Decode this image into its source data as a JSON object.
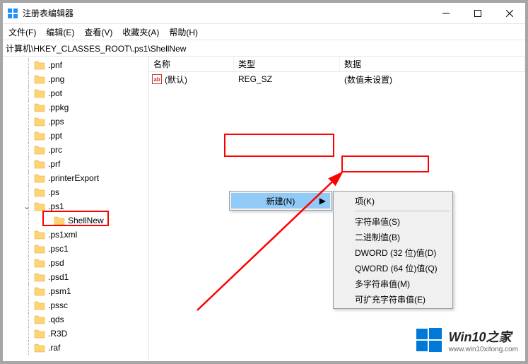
{
  "window": {
    "title": "注册表编辑器"
  },
  "menu": {
    "file": "文件(F)",
    "edit": "编辑(E)",
    "view": "查看(V)",
    "favorites": "收藏夹(A)",
    "help": "帮助(H)"
  },
  "address": "计算机\\HKEY_CLASSES_ROOT\\.ps1\\ShellNew",
  "tree": {
    "items": [
      ".pnf",
      ".png",
      ".pot",
      ".ppkg",
      ".pps",
      ".ppt",
      ".prc",
      ".prf",
      ".printerExport",
      ".ps",
      ".ps1",
      "ShellNew",
      ".ps1xml",
      ".psc1",
      ".psd",
      ".psd1",
      ".psm1",
      ".pssc",
      ".qds",
      ".R3D",
      ".raf"
    ],
    "selected_label": "ShellNew"
  },
  "columns": {
    "name": "名称",
    "type": "类型",
    "data": "数据"
  },
  "values": [
    {
      "name": "(默认)",
      "type": "REG_SZ",
      "data": "(数值未设置)"
    }
  ],
  "context": {
    "new": "新建(N)"
  },
  "submenu": {
    "key": "项(K)",
    "string": "字符串值(S)",
    "binary": "二进制值(B)",
    "dword": "DWORD (32 位)值(D)",
    "qword": "QWORD (64 位)值(Q)",
    "multi": "多字符串值(M)",
    "expand": "可扩充字符串值(E)"
  },
  "watermark": {
    "title": "Win10之家",
    "url": "www.win10xitong.com"
  }
}
